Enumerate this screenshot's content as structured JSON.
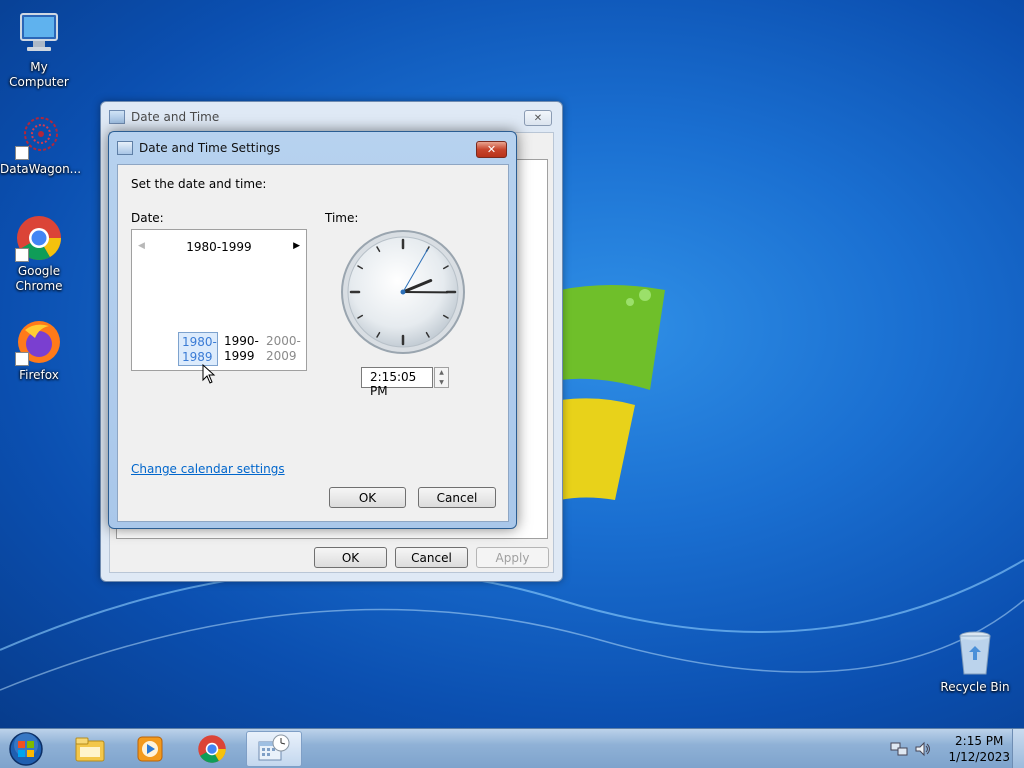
{
  "desktop": {
    "icons": [
      {
        "label": "My Computer",
        "icon": "computer-icon"
      },
      {
        "label": "DataWagon...",
        "icon": "datawagon-icon"
      },
      {
        "label": "Google Chrome",
        "icon": "chrome-icon"
      },
      {
        "label": "Firefox",
        "icon": "firefox-icon"
      },
      {
        "label": "Recycle Bin",
        "icon": "recycle-bin-icon"
      }
    ]
  },
  "outer_window": {
    "title": "Date and Time",
    "close_label": "✕",
    "ok_label": "OK",
    "cancel_label": "Cancel",
    "apply_label": "Apply"
  },
  "settings_dialog": {
    "title": "Date and Time Settings",
    "close_label": "✕",
    "instruction": "Set the date and time:",
    "date_label": "Date:",
    "time_label": "Time:",
    "calendar": {
      "header": "1980-1999",
      "prev_symbol": "◀",
      "next_symbol": "▶",
      "decades": [
        {
          "line1": "1980-",
          "line2": "1989",
          "selected": true
        },
        {
          "line1": "1990-",
          "line2": "1999",
          "selected": false
        },
        {
          "line1": "2000-",
          "line2": "2009",
          "selected": false
        }
      ]
    },
    "time_value": "2:15:05 PM",
    "change_calendar_link": "Change calendar settings",
    "ok_label": "OK",
    "cancel_label": "Cancel"
  },
  "taskbar": {
    "clock_time": "2:15 PM",
    "clock_date": "1/12/2023",
    "items": [
      "start-orb-icon",
      "file-explorer-icon",
      "media-player-icon",
      "chrome-icon",
      "date-time-icon"
    ]
  },
  "colors": {
    "link": "#0066cc",
    "selection": "#dcebfc",
    "close_red": "#c7452c"
  }
}
